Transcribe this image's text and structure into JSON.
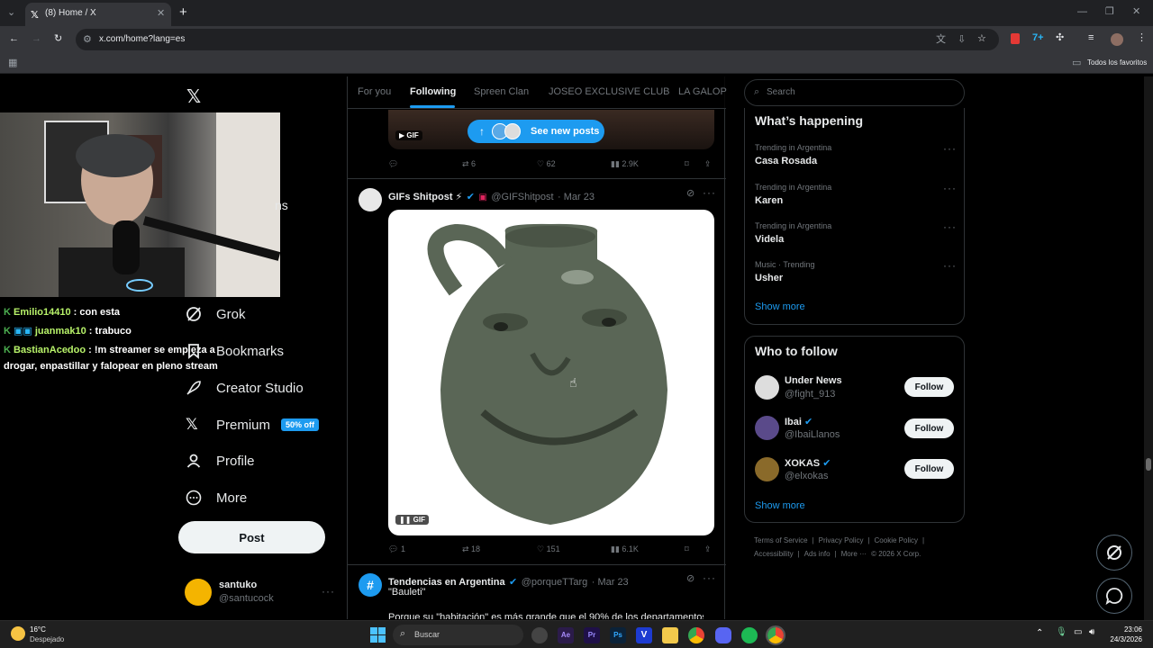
{
  "browser": {
    "tab_title": "(8) Home / X",
    "url": "x.com/home?lang=es",
    "bookmarks_folder": "Todos los favoritos"
  },
  "nav": {
    "partial_label": "ns",
    "items": [
      {
        "label": "Grok",
        "icon": "grok-icon"
      },
      {
        "label": "Bookmarks",
        "icon": "bookmark-icon"
      },
      {
        "label": "Creator Studio",
        "icon": "rocket-icon"
      },
      {
        "label": "Premium",
        "icon": "x-logo-icon",
        "badge": "50% off"
      },
      {
        "label": "Profile",
        "icon": "person-icon"
      },
      {
        "label": "More",
        "icon": "more-circle-icon"
      }
    ],
    "post_label": "Post",
    "account": {
      "name": "santuko",
      "handle": "@santucock"
    }
  },
  "chat": [
    {
      "user": "Emilio14410",
      "text": " : con esta"
    },
    {
      "user": "juanmak10",
      "text": " : trabuco"
    },
    {
      "user": "BastianAcedoo",
      "text": " : !m streamer se empieza a",
      "cont": "drogar, enpastillar y falopear en pleno stream"
    }
  ],
  "timeline": {
    "tabs": [
      "For you",
      "Following",
      "Spreen Clan",
      "JOSEO EXCLUSIVE CLUB",
      "LA GALOP"
    ],
    "active_tab": "Following",
    "new_posts": "See new posts",
    "gif_badge": "GIF",
    "prev_post_actions": {
      "replies": "",
      "reposts": "6",
      "likes": "62",
      "views": "2.9K"
    },
    "post1": {
      "name": "GIFs Shitpost ⚡",
      "handle": "@GIFShitpost",
      "date": "· Mar 23",
      "actions": {
        "replies": "1",
        "reposts": "18",
        "likes": "151",
        "views": "6.1K"
      }
    },
    "post2": {
      "name": "Tendencias en Argentina",
      "handle": "@porqueTTarg",
      "date": "· Mar 23",
      "text": "\"Bauleti\"",
      "text2": "Porque su \"habitación\" es más grande que el 90% de los departamentos"
    }
  },
  "right": {
    "search_placeholder": "Search",
    "happening_title": "What’s happening",
    "trends": [
      {
        "context": "Trending in Argentina",
        "name": "Casa Rosada"
      },
      {
        "context": "Trending in Argentina",
        "name": "Karen"
      },
      {
        "context": "Trending in Argentina",
        "name": "Videla"
      },
      {
        "context": "Music · Trending",
        "name": "Usher"
      }
    ],
    "show_more": "Show more",
    "follow_title": "Who to follow",
    "follow": [
      {
        "name": "Under News",
        "handle": "@fight_913",
        "verified": false,
        "button": "Follow"
      },
      {
        "name": "Ibai",
        "handle": "@IbaiLlanos",
        "verified": true,
        "button": "Follow"
      },
      {
        "name": "XOKAS",
        "handle": "@elxokas",
        "verified": true,
        "button": "Follow"
      }
    ],
    "footer": [
      "Terms of Service",
      "|",
      "Privacy Policy",
      "|",
      "Cookie Policy",
      "|",
      "Accessibility",
      "|",
      "Ads info",
      "|",
      "More ···",
      "© 2026 X Corp."
    ]
  },
  "taskbar": {
    "weather_temp": "16°C",
    "weather_desc": "Despejado",
    "search_label": "Buscar",
    "time": "23:06",
    "date": "24/3/2026"
  },
  "colors": {
    "accent": "#1d9bf0",
    "bg": "#000000",
    "border": "#2f3336",
    "chat_user": "#b8f36a"
  }
}
